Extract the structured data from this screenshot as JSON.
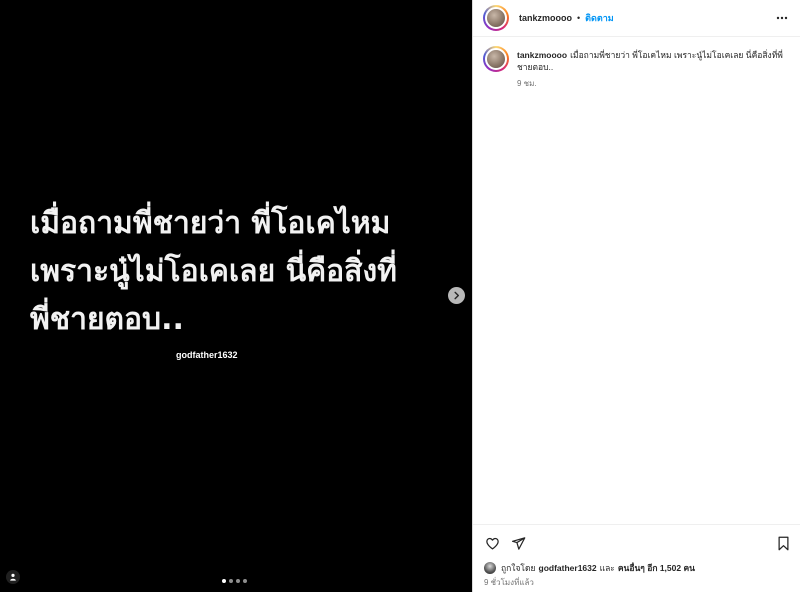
{
  "media": {
    "image_text": "เมื่อถามพี่ชายว่า พี่โอเคไหม\nเพราะนู๋ไม่โอเคเลย นี่คือสิ่งที่\nพี่ชายตอบ..",
    "credit": "godfather1632",
    "carousel": {
      "total": 4,
      "current": 1
    },
    "icons": {
      "next": "chevron-right-icon",
      "tag": "person-tag-icon"
    }
  },
  "header": {
    "username": "tankzmoooo",
    "separator": "•",
    "follow_label": "ติดตาม",
    "more_icon": "more-horizontal-icon"
  },
  "caption": {
    "username": "tankzmoooo",
    "text": "เมื่อถามพี่ชายว่า พี่โอเคไหม เพราะนู๋ไม่โอเคเลย นี่คือสิ่งที่พี่ชายตอบ..",
    "time": "9 ชม."
  },
  "footer": {
    "icons": {
      "like": "heart-icon",
      "share": "send-icon",
      "save": "bookmark-icon"
    },
    "likes": {
      "prefix": "ถูกใจโดย",
      "user": "godfather1632",
      "connector": "และ",
      "others": "คนอื่นๆ อีก 1,502 คน"
    },
    "time": "9 ชั่วโมงที่แล้ว"
  },
  "colors": {
    "accent": "#0095f6",
    "text_primary": "#262626",
    "text_secondary": "#737373",
    "media_background": "#000000"
  }
}
